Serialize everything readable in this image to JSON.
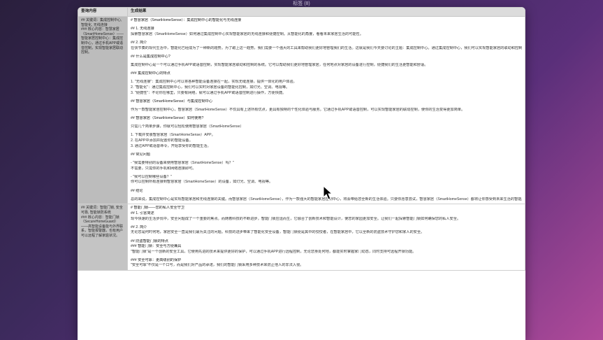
{
  "window_title": "标签 (8)",
  "table": {
    "headers": [
      "查询内容",
      "生成结果"
    ],
    "rows": [
      {
        "query": "## 关键词：集成控制中心, 智能化, 无线连接\n### 核心内容：智慧家居（SmartHomeSense）——智能家居控制中心：集成控制中心，通过手机APP或语音控制，实现智能家居联动控制。",
        "result": [
          "# 智慧家居（SmartHomeSense）：集成控制中心的智能化与无线连接",
          "",
          "## 1. 无线连接",
          "探索智慧家居（SmartHomeSense）如何通过集成控制中心实现智能家居的无线连接和便捷控制。从智能化的角度，看看未来家居生活的可能性。",
          "",
          "## 2. 简介",
          "在快节奏的现代生活中，智能化已经成为了一种新的趋势。为了跟上这一趋势，我们需要一个强大的工具来帮助我们更好地管理我们的生活。这就是我们今天要讨论的主题：集成控制中心。通过集成控制中心，我们可以实现智能家居的联动和控制，让生活更加便捷和舒适。",
          "",
          "## 什么是集成控制中心?",
          "",
          "集成控制中心是一个可以通过手机APP或语音控制，实现智能家居联动和控制的系统。它可以帮助我们更好地管理家居，任何地点对家居的设备进行控制，便捷我们的生活更智能和舒适。",
          "",
          "### 集成控制中心的特点",
          "",
          "1. \"无线连接\"：集成控制中心可以将各种智能设备连接在一起，实现无缝连接，提供一体化的用户体验。",
          "2. \"智能化\"：通过集成控制中心，我们可以实时对家居设备的智能化控制，如灯光、空调、电视等。",
          "3. \"便捷性\"：不论你在哪里，只要有网络，就可以通过手机APP或语音控制进行操作，方便快捷。",
          "",
          "## 智慧家居（SmartHomeSense）与集成控制中心",
          "",
          "作为一款智能家居控制中心，智慧家居（SmartHomeSense）不仅具有上述所有优点，更具有独特的个性化体验与服务。它通过手机APP或语音控制，可以实现智能家居的联动控制，使你的生活变得更加简单。",
          "",
          "## 智慧家居（SmartHomeSense）如何使用?",
          "",
          "只需几个简单步骤，你就可以轻松使用智慧家居（SmartHomeSense）",
          "",
          "1. 下载并安装智慧家居（SmartHomeSense）APP。",
          "2. 在APP中添加并配置你的智能设备。",
          "3. 通过APP或语音命令，开始享受你的智能生活。",
          "",
          "## 常见问题",
          "",
          "- \"我需要特别的设备来使用智慧家居（SmartHomeSense）吗？\"",
          "  不需要，只需你的手机和网络连接即可。",
          "",
          "- \"我可以控制哪些设备？\"",
          "  你可以控制所有连接到智慧家居（SmartHomeSense）的设备，如灯光、空调、电视等。",
          "",
          "## 结论",
          "",
          "总的来说，集成控制中心是实现智能家居和无线连接的关键。而智慧家居（SmartHomeSense），作为一款强大的智能家居控制中心，将会带给您全新的生活体验。只要你愿意尝试，智慧家居（SmartHomeSense）都将让你感受到未来生活的智能。"
        ]
      },
      {
        "query": "## 关键词：智能门锁, 安全可靠, 智能锁防系统\n### 核心内容：智能门锁（SecureHomeGuard）——高智能设备能与外界联系，智能报警器，也有用户可以远程了解家庭状况。",
        "result": [
          "# 智能门锁——您的私人安全守卫",
          "## 1. 引言简述",
          "现今快速的生活步伐中，安全问题成了一个重要的焦点。而随着科技的不断进步，智能门锁应运而生，它融合了创新技术和智能设计，使您的家园更加安全。让我们一起探索智能门锁如何确保您的私人安全。",
          "",
          "## 2. 简介",
          "无论您是何时何地，家居安全一直是我们最为关注的问题。科技的进步带来了智能化安全设备，智能门锁便是其中的佼佼者，在智能家居中，它以全新的防盗技术守护您和家人的安全。",
          "",
          "## 防盗智能门锁的特点",
          "### 智能门锁：安全与方便兼具",
          "\"智能门锁\"是一个创新的安全工具，它使用先进的技术来提供更好的保护，可以通过手机APP进行远程控制，无论您身处何地，都能实时掌握家门动态，同时支持可远程开锁功能。",
          "",
          "### 安全可靠：更高级别的保护",
          "\"安全可靠\"不仅是一个口号，而是我们对产品的承诺，我们的智能门锁采用多种技术来防止他人的非法入侵。"
        ]
      }
    ]
  }
}
